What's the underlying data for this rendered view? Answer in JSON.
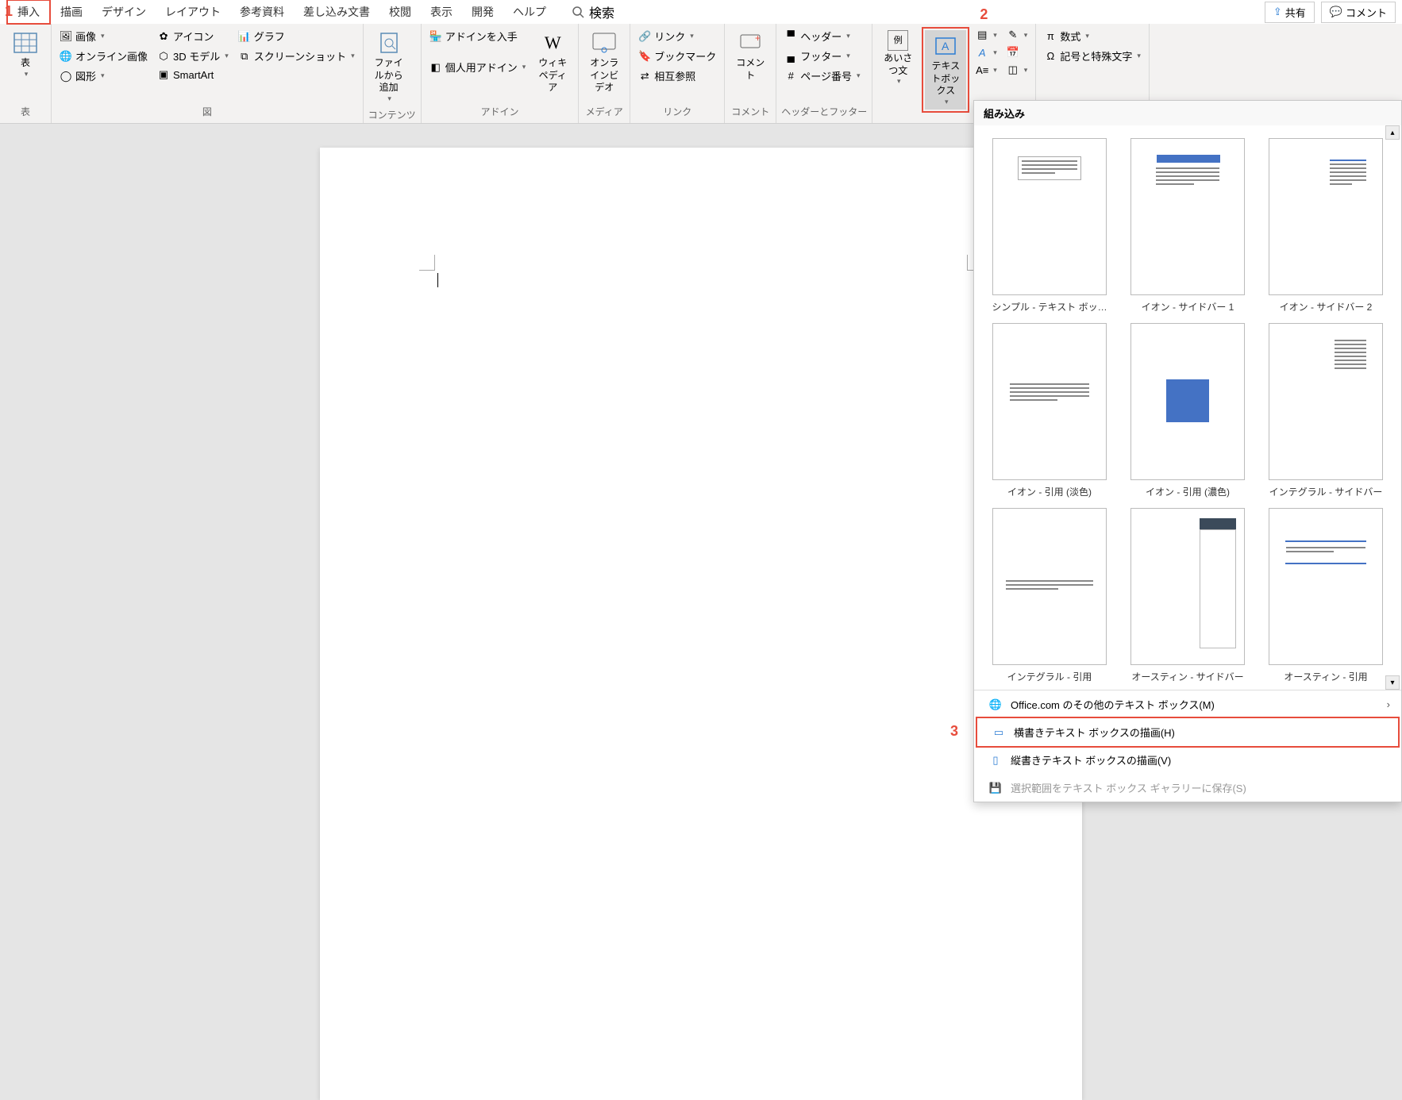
{
  "tabs": [
    "挿入",
    "描画",
    "デザイン",
    "レイアウト",
    "参考資料",
    "差し込み文書",
    "校閲",
    "表示",
    "開発",
    "ヘルプ"
  ],
  "search_label": "検索",
  "top_buttons": {
    "share": "共有",
    "comment": "コメント"
  },
  "annotations": {
    "n1": "1",
    "n2": "2",
    "n3": "3"
  },
  "ribbon": {
    "table": {
      "btn": "表",
      "group": "表"
    },
    "illustrations": {
      "image": "画像",
      "online_image": "オンライン画像",
      "shapes": "図形",
      "icon": "アイコン",
      "3d_model": "3D モデル",
      "smartart": "SmartArt",
      "chart": "グラフ",
      "screenshot": "スクリーンショット",
      "group": "図"
    },
    "contents": {
      "file_reuse": "ファイルから追加",
      "group": "コンテンツ"
    },
    "addins": {
      "get": "アドインを入手",
      "my": "個人用アドイン",
      "wiki": "ウィキペディア",
      "group": "アドイン"
    },
    "media": {
      "video": "オンラインビデオ",
      "group": "メディア"
    },
    "link": {
      "link": "リンク",
      "bookmark": "ブックマーク",
      "cross": "相互参照",
      "group": "リンク"
    },
    "comment": {
      "btn": "コメント",
      "group": "コメント"
    },
    "headerfooter": {
      "header": "ヘッダー",
      "footer": "フッター",
      "page_num": "ページ番号",
      "group": "ヘッダーとフッター"
    },
    "text": {
      "greeting": "あいさつ文",
      "textbox": "テキストボックス"
    },
    "symbols": {
      "equation": "数式",
      "symbol": "記号と特殊文字"
    }
  },
  "gallery": {
    "title": "組み込み",
    "items": [
      "シンプル - テキスト ボッ…",
      "イオン - サイドバー 1",
      "イオン - サイドバー 2",
      "イオン - 引用 (淡色)",
      "イオン - 引用 (濃色)",
      "インテグラル - サイドバー",
      "インテグラル - 引用",
      "オースティン - サイドバー",
      "オースティン - 引用"
    ],
    "menu": {
      "office": "Office.com のその他のテキスト ボックス(M)",
      "horizontal": "横書きテキスト ボックスの描画(H)",
      "vertical": "縦書きテキスト ボックスの描画(V)",
      "save": "選択範囲をテキスト ボックス ギャラリーに保存(S)"
    }
  }
}
